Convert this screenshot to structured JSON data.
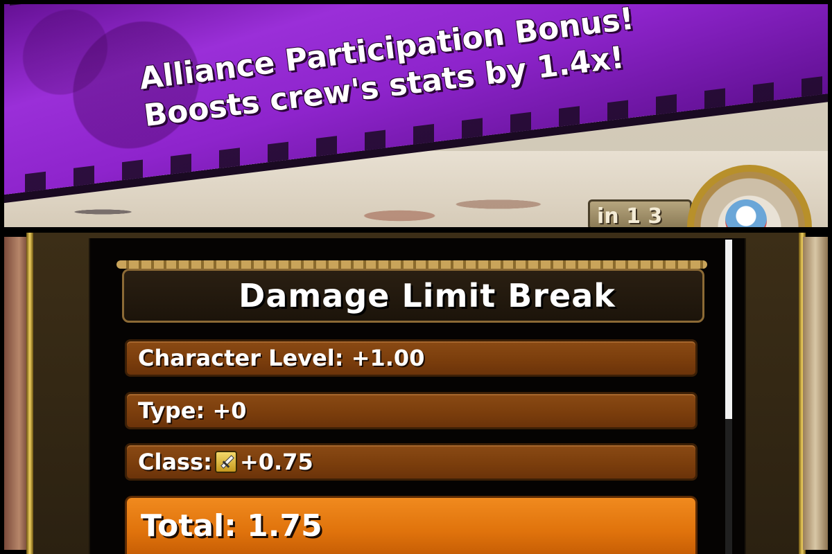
{
  "banner": {
    "line1": "Alliance Participation Bonus!",
    "line2": "Boosts crew's stats by 1.4x!",
    "turn_badge": "in 1 3"
  },
  "panel": {
    "title": "Damage Limit Break",
    "rows": [
      {
        "label": "Character Level: +1.00"
      },
      {
        "label": "Type: +0"
      },
      {
        "label_prefix": "Class:",
        "icon": "sword-class-icon",
        "label_suffix": "+0.75"
      }
    ],
    "total": "Total: 1.75"
  },
  "colors": {
    "banner_purple": "#8e24cc",
    "row_brown": "#7a3d0c",
    "total_orange": "#e0730c",
    "gold_rail": "#f0d060"
  },
  "scroll": {
    "position_fraction": 0.0,
    "visible_fraction": 0.57
  }
}
